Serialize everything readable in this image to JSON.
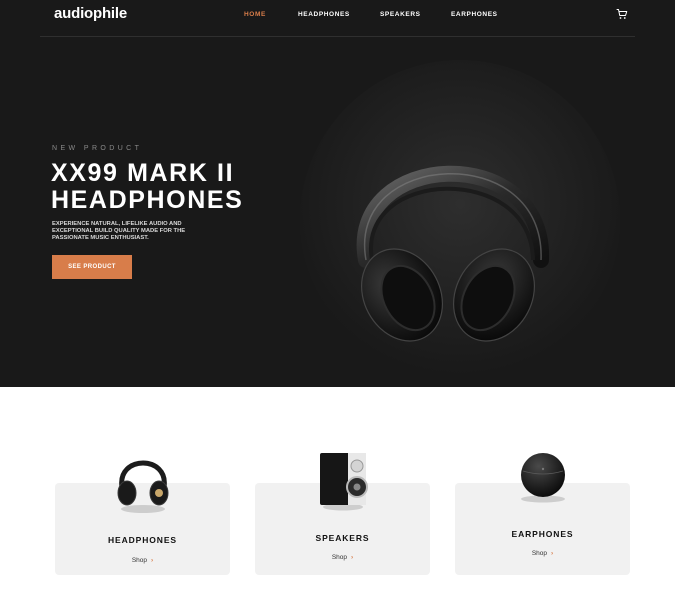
{
  "nav": {
    "logo": "audiophile",
    "links": [
      {
        "label": "HOME",
        "active": true
      },
      {
        "label": "HEADPHONES",
        "active": false
      },
      {
        "label": "SPEAKERS",
        "active": false
      },
      {
        "label": "EARPHONES",
        "active": false
      }
    ],
    "cart_icon": "cart-icon"
  },
  "hero": {
    "eyebrow": "NEW PRODUCT",
    "title_line1": "XX99 MARK II",
    "title_line2": "HEADPHONES",
    "description": "EXPERIENCE NATURAL, LIFELIKE AUDIO AND EXCEPTIONAL BUILD QUALITY MADE FOR THE PASSIONATE MUSIC ENTHUSIAST.",
    "cta_label": "SEE PRODUCT",
    "image_icon": "headphones-image"
  },
  "categories": [
    {
      "label": "HEADPHONES",
      "shop_label": "Shop",
      "arrow": "›",
      "image_icon": "headphones-thumbnail"
    },
    {
      "label": "SPEAKERS",
      "shop_label": "Shop",
      "arrow": "›",
      "image_icon": "speaker-thumbnail"
    },
    {
      "label": "EARPHONES",
      "shop_label": "Shop",
      "arrow": "›",
      "image_icon": "earphones-case-thumbnail"
    }
  ],
  "colors": {
    "accent": "#d87d4a",
    "hero_bg": "#191919",
    "card_bg": "#f1f1f1"
  }
}
